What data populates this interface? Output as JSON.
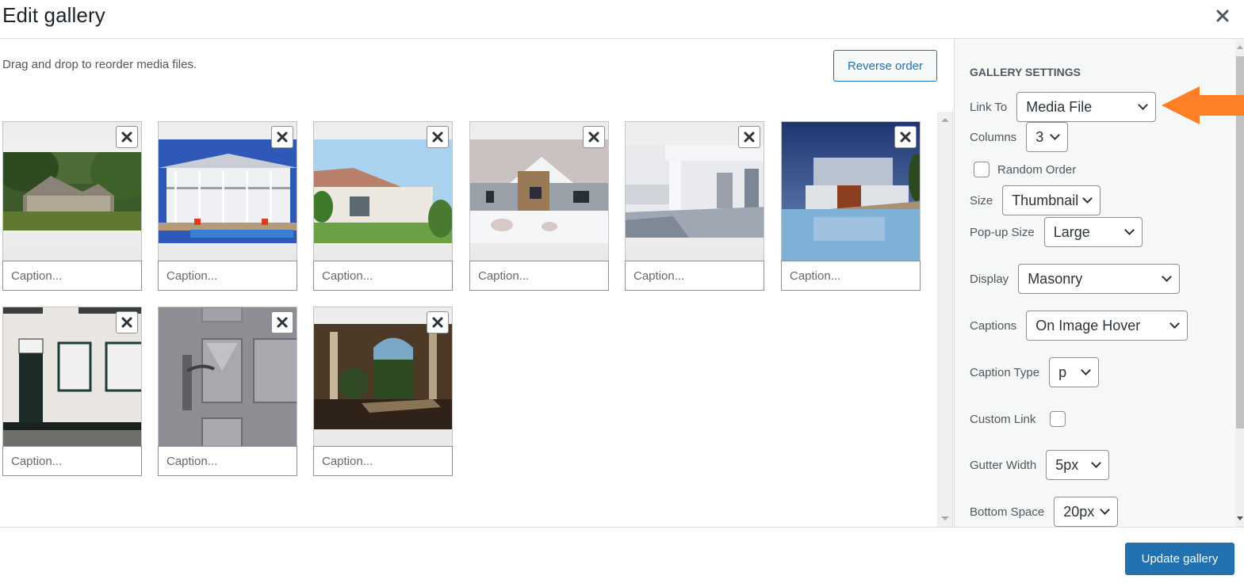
{
  "header": {
    "title": "Edit gallery",
    "close_icon": "close-x-icon"
  },
  "media": {
    "instruction": "Drag and drop to reorder media files.",
    "reverse_order_label": "Reverse order",
    "caption_placeholder": "Caption...",
    "items": [
      {
        "description": "Suburban house among trees",
        "caption": ""
      },
      {
        "description": "White two-story beach house with pool",
        "caption": ""
      },
      {
        "description": "Mediterranean villa with lawn",
        "caption": ""
      },
      {
        "description": "Brick house in snow",
        "caption": ""
      },
      {
        "description": "Modern white house porch with steps",
        "caption": ""
      },
      {
        "description": "Modern villa with pool at dusk",
        "caption": ""
      },
      {
        "description": "White brick facade with dark door",
        "caption": ""
      },
      {
        "description": "Gray paneled door with handle",
        "caption": ""
      },
      {
        "description": "Arched hallway with plant",
        "caption": ""
      }
    ]
  },
  "settings": {
    "title": "Gallery Settings",
    "link_to": {
      "label": "Link To",
      "value": "Media File"
    },
    "columns": {
      "label": "Columns",
      "value": "3"
    },
    "random_order": {
      "label": "Random Order",
      "checked": false
    },
    "size": {
      "label": "Size",
      "value": "Thumbnail"
    },
    "popup_size": {
      "label": "Pop-up Size",
      "value": "Large"
    },
    "display": {
      "label": "Display",
      "value": "Masonry"
    },
    "captions": {
      "label": "Captions",
      "value": "On Image Hover"
    },
    "caption_type": {
      "label": "Caption Type",
      "value": "p"
    },
    "custom_link": {
      "label": "Custom Link",
      "checked": false
    },
    "gutter_width": {
      "label": "Gutter Width",
      "value": "5px"
    },
    "bottom_space": {
      "label": "Bottom Space",
      "value": "20px"
    }
  },
  "annotation": {
    "arrow_color": "#ff7f27",
    "points_to": "link_to"
  },
  "footer": {
    "update_label": "Update gallery"
  },
  "colors": {
    "primary": "#2271b1",
    "arrow": "#ff7f27"
  }
}
